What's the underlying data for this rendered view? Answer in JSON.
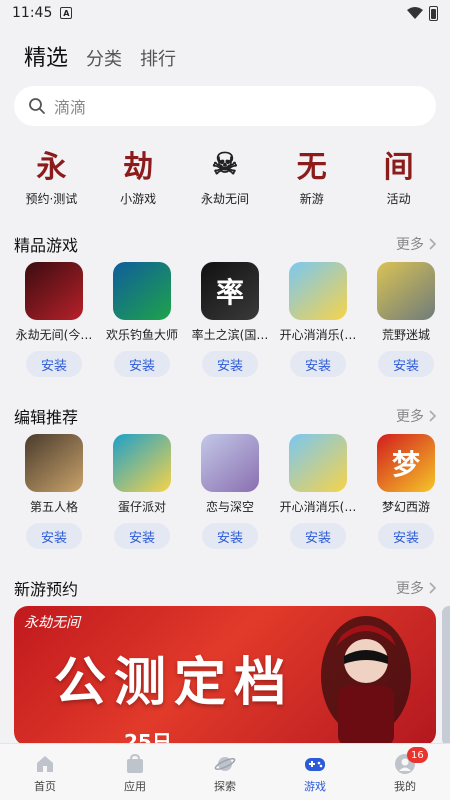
{
  "status_bar": {
    "time": "11:45",
    "notification_glyph": "A"
  },
  "tabs": [
    {
      "label": "精选",
      "active": true
    },
    {
      "label": "分类",
      "active": false
    },
    {
      "label": "排行",
      "active": false
    }
  ],
  "search": {
    "placeholder": "滴滴"
  },
  "quick_links": [
    {
      "label": "预约·测试",
      "glyph": "永",
      "icon": "calligraphy-icon"
    },
    {
      "label": "小游戏",
      "glyph": "劫",
      "icon": "calligraphy-icon"
    },
    {
      "label": "永劫无间",
      "glyph": "☠",
      "icon": "character-face-icon"
    },
    {
      "label": "新游",
      "glyph": "无",
      "icon": "calligraphy-icon"
    },
    {
      "label": "活动",
      "glyph": "间",
      "icon": "calligraphy-icon"
    }
  ],
  "sections": {
    "featured": {
      "title": "精品游戏",
      "more": "更多",
      "games": [
        {
          "name": "永劫无间(今…",
          "install": "安装"
        },
        {
          "name": "欢乐钓鱼大师",
          "install": "安装"
        },
        {
          "name": "率土之滨(国…",
          "install": "安装"
        },
        {
          "name": "开心消消乐(…",
          "install": "安装"
        },
        {
          "name": "荒野迷城",
          "install": "安装"
        }
      ]
    },
    "editor": {
      "title": "编辑推荐",
      "more": "更多",
      "games": [
        {
          "name": "第五人格",
          "install": "安装"
        },
        {
          "name": "蛋仔派对",
          "install": "安装"
        },
        {
          "name": "恋与深空",
          "install": "安装"
        },
        {
          "name": "开心消消乐(…",
          "install": "安装"
        },
        {
          "name": "梦幻西游",
          "install": "安装"
        }
      ]
    },
    "new_games": {
      "title": "新游预约",
      "more": "更多",
      "banner": {
        "small_title": "永劫无间",
        "big_title": "公测定档",
        "date": "25日"
      }
    }
  },
  "icon_art": {
    "featured": [
      {
        "c1": "#3a0d10",
        "c2": "#b8202a",
        "text": ""
      },
      {
        "c1": "#0f5d9c",
        "c2": "#1fa34a",
        "text": ""
      },
      {
        "c1": "#111111",
        "c2": "#3a3a3a",
        "text": "率"
      },
      {
        "c1": "#7ac7f2",
        "c2": "#f6d34a",
        "text": ""
      },
      {
        "c1": "#d9c255",
        "c2": "#6f7c7a",
        "text": ""
      }
    ],
    "editor": [
      {
        "c1": "#4a3b2e",
        "c2": "#c9a36a",
        "text": ""
      },
      {
        "c1": "#1ea0c9",
        "c2": "#f6d34a",
        "text": ""
      },
      {
        "c1": "#c3c8e8",
        "c2": "#8a6fb0",
        "text": ""
      },
      {
        "c1": "#7ac7f2",
        "c2": "#f6d34a",
        "text": ""
      },
      {
        "c1": "#d21d1d",
        "c2": "#f5c629",
        "text": "梦"
      }
    ]
  },
  "bottom_nav": [
    {
      "label": "首页",
      "icon": "home-icon",
      "active": false
    },
    {
      "label": "应用",
      "icon": "apps-bag-icon",
      "active": false
    },
    {
      "label": "探索",
      "icon": "planet-icon",
      "active": false
    },
    {
      "label": "游戏",
      "icon": "gamepad-icon",
      "active": true
    },
    {
      "label": "我的",
      "icon": "profile-icon",
      "active": false,
      "badge": "16"
    }
  ],
  "colors": {
    "accent": "#2b5bd7",
    "install_bg": "#e4e8f2",
    "badge": "#e8342d",
    "banner": "#c0191e"
  }
}
